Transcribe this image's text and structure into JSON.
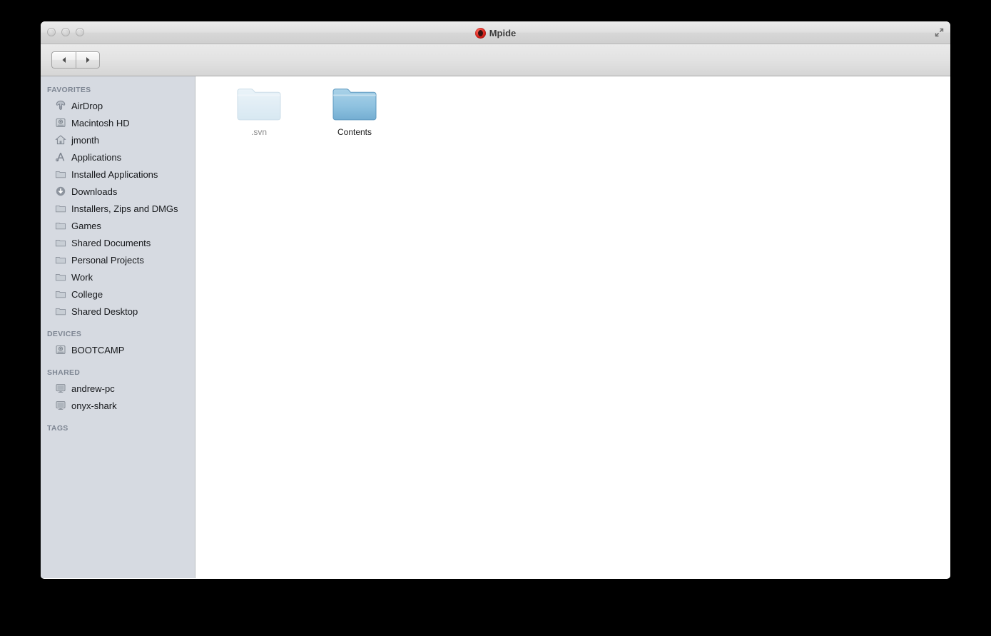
{
  "window": {
    "title": "Mpide",
    "title_icon": "mpide-app-icon",
    "traffic_lights": [
      "close",
      "minimize",
      "zoom"
    ],
    "fullscreen_icon": "fullscreen-expand-icon"
  },
  "toolbar": {
    "back_icon": "back-arrow-icon",
    "forward_icon": "forward-arrow-icon",
    "view_modes": [
      {
        "name": "icon-view",
        "icon": "grid-icon",
        "active": true
      },
      {
        "name": "list-view",
        "icon": "list-icon",
        "active": false
      },
      {
        "name": "column-view",
        "icon": "columns-icon",
        "active": false
      },
      {
        "name": "coverflow-view",
        "icon": "coverflow-icon",
        "active": false
      }
    ],
    "arrange_icon": "arrange-grid-icon",
    "share_icon": "share-icon",
    "tag_icon": "tag-pill-icon",
    "quicklook_icon": "eye-icon",
    "action_icon": "gear-icon"
  },
  "search": {
    "icon": "search-icon",
    "value": "",
    "placeholder": ""
  },
  "sidebar": {
    "sections": [
      {
        "label": "Favorites",
        "items": [
          {
            "label": "AirDrop",
            "icon": "airdrop-icon"
          },
          {
            "label": "Macintosh HD",
            "icon": "harddrive-icon"
          },
          {
            "label": "jmonth",
            "icon": "home-icon"
          },
          {
            "label": "Applications",
            "icon": "applications-icon"
          },
          {
            "label": "Installed Applications",
            "icon": "folder-icon"
          },
          {
            "label": "Downloads",
            "icon": "downloads-icon"
          },
          {
            "label": "Installers, Zips and DMGs",
            "icon": "folder-icon"
          },
          {
            "label": "Games",
            "icon": "folder-icon"
          },
          {
            "label": "Shared Documents",
            "icon": "folder-icon"
          },
          {
            "label": "Personal Projects",
            "icon": "folder-icon"
          },
          {
            "label": "Work",
            "icon": "folder-icon"
          },
          {
            "label": "College",
            "icon": "folder-icon"
          },
          {
            "label": "Shared Desktop",
            "icon": "folder-icon"
          }
        ]
      },
      {
        "label": "Devices",
        "items": [
          {
            "label": "BOOTCAMP",
            "icon": "harddrive-icon"
          }
        ]
      },
      {
        "label": "Shared",
        "items": [
          {
            "label": "andrew-pc",
            "icon": "display-icon"
          },
          {
            "label": "onyx-shark",
            "icon": "display-icon"
          }
        ]
      },
      {
        "label": "Tags",
        "items": []
      }
    ]
  },
  "content": {
    "files": [
      {
        "label": ".svn",
        "icon": "folder-icon",
        "hidden": true
      },
      {
        "label": "Contents",
        "icon": "folder-icon",
        "hidden": false
      }
    ]
  },
  "colors": {
    "sidebar_bg": "#d6dae1",
    "section_label": "#7e8693",
    "folder_blue": "#8fc2e0",
    "content_bg": "#ffffff",
    "desktop_bg": "#000000"
  }
}
